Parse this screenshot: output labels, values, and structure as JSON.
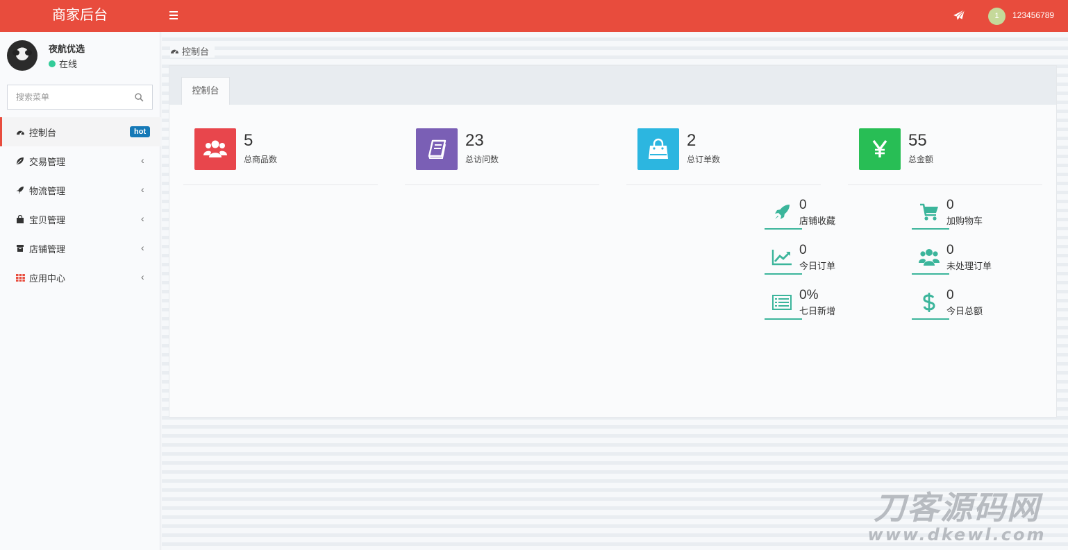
{
  "header": {
    "title": "商家后台",
    "user_avatar_text": "1",
    "user_name": "123456789",
    "bg_color": "#e84c3d"
  },
  "sidebar": {
    "profile_name": "夜航优选",
    "profile_status": "在线",
    "search_placeholder": "搜索菜单",
    "items": [
      {
        "label": "控制台",
        "icon": "dashboard-icon",
        "badge": "hot"
      },
      {
        "label": "交易管理",
        "icon": "leaf-icon"
      },
      {
        "label": "物流管理",
        "icon": "rocket-icon"
      },
      {
        "label": "宝贝管理",
        "icon": "shopping-bag-icon"
      },
      {
        "label": "店铺管理",
        "icon": "box-icon"
      },
      {
        "label": "应用中心",
        "icon": "grid-icon"
      }
    ]
  },
  "breadcrumb": "控制台",
  "tab": "控制台",
  "stats": [
    {
      "value": "5",
      "label": "总商品数",
      "icon": "users-icon",
      "color": "#e8464c"
    },
    {
      "value": "23",
      "label": "总访问数",
      "icon": "book-icon",
      "color": "#7a5fb5"
    },
    {
      "value": "2",
      "label": "总订单数",
      "icon": "shopping-bag-icon",
      "color": "#2cb6e0"
    },
    {
      "value": "55",
      "label": "总金额",
      "icon": "yen-icon",
      "color": "#28be55"
    }
  ],
  "mini_stats": [
    {
      "value": "0",
      "label": "店铺收藏",
      "icon": "rocket-icon"
    },
    {
      "value": "0",
      "label": "加购物车",
      "icon": "cart-icon"
    },
    {
      "value": "0",
      "label": "今日订单",
      "icon": "line-chart-icon"
    },
    {
      "value": "0",
      "label": "未处理订单",
      "icon": "users-icon"
    },
    {
      "value": "0%",
      "label": "七日新增",
      "icon": "list-alt-icon"
    },
    {
      "value": "0",
      "label": "今日总额",
      "icon": "dollar-icon"
    }
  ],
  "accent_color": "#3bb59b",
  "watermark": {
    "title": "刀客源码网",
    "url": "www.dkewl.com"
  }
}
